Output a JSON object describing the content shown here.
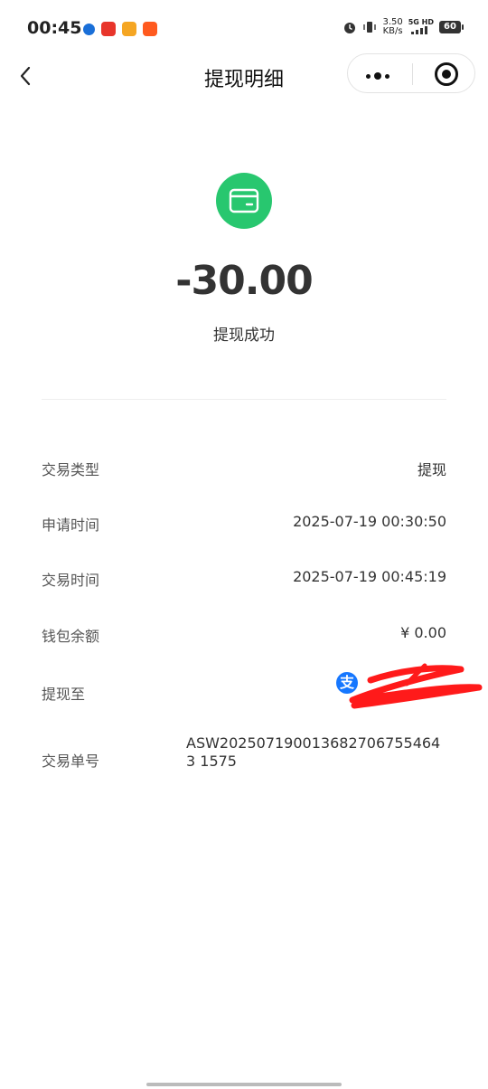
{
  "status_bar": {
    "time": "00:45",
    "speed_value": "3.50",
    "speed_unit": "KB/s",
    "network_top": "5G HD",
    "battery": "60"
  },
  "nav": {
    "title": "提现明细"
  },
  "summary": {
    "amount": "-30.00",
    "status": "提现成功",
    "icon_color": "#28c76f"
  },
  "details": {
    "type_label": "交易类型",
    "type_value": "提现",
    "apply_time_label": "申请时间",
    "apply_time_value": "2025-07-19 00:30:50",
    "trade_time_label": "交易时间",
    "trade_time_value": "2025-07-19 00:45:19",
    "balance_label": "钱包余额",
    "balance_value": "¥ 0.00",
    "withdraw_to_label": "提现至",
    "withdraw_to_icon_char": "支",
    "order_label": "交易单号",
    "order_value": "ASW2025071900136827067554643 1575"
  },
  "colors": {
    "accent_green": "#28c76f",
    "alipay_blue": "#1677ff",
    "redact_red": "#ff1a1a"
  }
}
